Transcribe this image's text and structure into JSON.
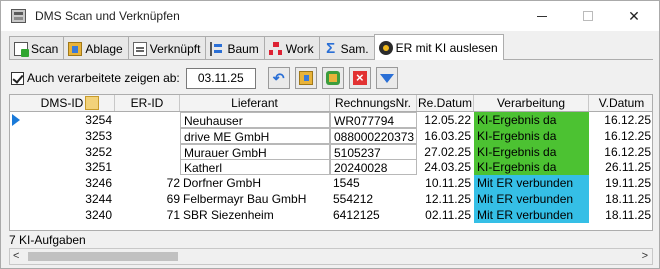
{
  "window": {
    "title": "DMS Scan und Verknüpfen",
    "min": "—",
    "close": "✕"
  },
  "tabs": [
    {
      "label": "Scan",
      "icon": "scan-icon"
    },
    {
      "label": "Ablage",
      "icon": "folder-icon"
    },
    {
      "label": "Verknüpft",
      "icon": "link-icon"
    },
    {
      "label": "Baum",
      "icon": "tree-icon"
    },
    {
      "label": "Work",
      "icon": "workflow-icon"
    },
    {
      "label": "Sam.",
      "icon": "sigma-icon"
    },
    {
      "label": "ER mit KI auslesen",
      "icon": "ai-icon",
      "active": true
    }
  ],
  "toolbar": {
    "show_processed_label": "Auch verarbeitete zeigen ab:",
    "show_processed_checked": true,
    "date_value": "03.11.25",
    "buttons": [
      "back-icon",
      "folder-icon",
      "group-icon",
      "delete-icon",
      "filter-icon"
    ]
  },
  "table": {
    "columns": [
      "DMS-ID",
      "ER-ID",
      "Lieferant",
      "RechnungsNr.",
      "Re.Datum",
      "Verarbeitung",
      "V.Datum"
    ],
    "rows": [
      {
        "dms_id": "3254",
        "er_id": "",
        "lieferant": "Neuhauser",
        "rechnungsnr": "WR077794",
        "re_datum": "12.05.22",
        "verarbeitung": "KI-Ergebnis da",
        "v_datum": "16.12.25",
        "status": "green"
      },
      {
        "dms_id": "3253",
        "er_id": "",
        "lieferant": "drive ME GmbH",
        "rechnungsnr": "088000220373",
        "re_datum": "16.03.25",
        "verarbeitung": "KI-Ergebnis da",
        "v_datum": "16.12.25",
        "status": "green"
      },
      {
        "dms_id": "3252",
        "er_id": "",
        "lieferant": "Murauer GmbH",
        "rechnungsnr": "5105237",
        "re_datum": "27.02.25",
        "verarbeitung": "KI-Ergebnis da",
        "v_datum": "16.12.25",
        "status": "green"
      },
      {
        "dms_id": "3251",
        "er_id": "",
        "lieferant": "Katherl",
        "rechnungsnr": "20240028",
        "re_datum": "24.03.25",
        "verarbeitung": "KI-Ergebnis da",
        "v_datum": "26.11.25",
        "status": "green"
      },
      {
        "dms_id": "3246",
        "er_id": "72",
        "lieferant": "Dorfner GmbH",
        "rechnungsnr": "1545",
        "re_datum": "10.11.25",
        "verarbeitung": "Mit ER verbunden",
        "v_datum": "19.11.25",
        "status": "cyan"
      },
      {
        "dms_id": "3244",
        "er_id": "69",
        "lieferant": "Felbermayr Bau GmbH",
        "rechnungsnr": "554212",
        "re_datum": "12.11.25",
        "verarbeitung": "Mit ER verbunden",
        "v_datum": "18.11.25",
        "status": "cyan"
      },
      {
        "dms_id": "3240",
        "er_id": "71",
        "lieferant": "SBR Siezenheim",
        "rechnungsnr": "6412125",
        "re_datum": "02.11.25",
        "verarbeitung": "Mit ER verbunden",
        "v_datum": "18.11.25",
        "status": "cyan"
      }
    ]
  },
  "statusbar": {
    "text": "7 KI-Aufgaben"
  },
  "colors": {
    "status_green": "#4cc232",
    "status_cyan": "#35bfe6",
    "accent": "#1a7ad9"
  }
}
